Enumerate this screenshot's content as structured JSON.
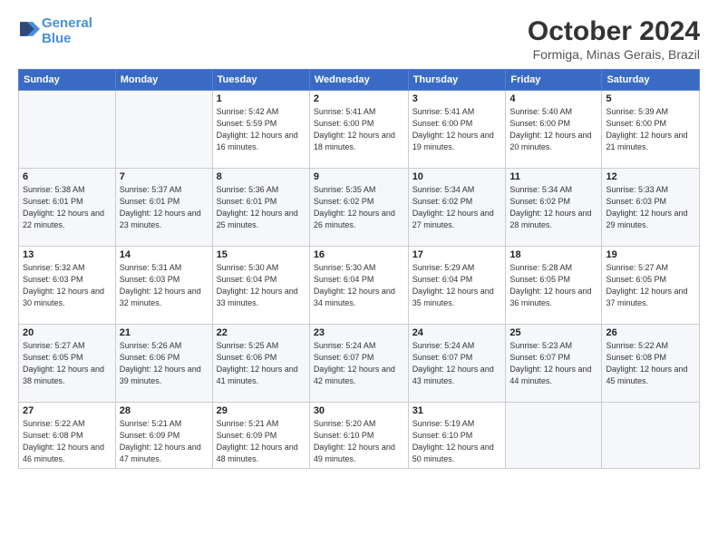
{
  "logo": {
    "line1": "General",
    "line2": "Blue"
  },
  "title": "October 2024",
  "subtitle": "Formiga, Minas Gerais, Brazil",
  "headers": [
    "Sunday",
    "Monday",
    "Tuesday",
    "Wednesday",
    "Thursday",
    "Friday",
    "Saturday"
  ],
  "weeks": [
    [
      {
        "day": "",
        "info": ""
      },
      {
        "day": "",
        "info": ""
      },
      {
        "day": "1",
        "info": "Sunrise: 5:42 AM\nSunset: 5:59 PM\nDaylight: 12 hours\nand 16 minutes."
      },
      {
        "day": "2",
        "info": "Sunrise: 5:41 AM\nSunset: 6:00 PM\nDaylight: 12 hours\nand 18 minutes."
      },
      {
        "day": "3",
        "info": "Sunrise: 5:41 AM\nSunset: 6:00 PM\nDaylight: 12 hours\nand 19 minutes."
      },
      {
        "day": "4",
        "info": "Sunrise: 5:40 AM\nSunset: 6:00 PM\nDaylight: 12 hours\nand 20 minutes."
      },
      {
        "day": "5",
        "info": "Sunrise: 5:39 AM\nSunset: 6:00 PM\nDaylight: 12 hours\nand 21 minutes."
      }
    ],
    [
      {
        "day": "6",
        "info": "Sunrise: 5:38 AM\nSunset: 6:01 PM\nDaylight: 12 hours\nand 22 minutes."
      },
      {
        "day": "7",
        "info": "Sunrise: 5:37 AM\nSunset: 6:01 PM\nDaylight: 12 hours\nand 23 minutes."
      },
      {
        "day": "8",
        "info": "Sunrise: 5:36 AM\nSunset: 6:01 PM\nDaylight: 12 hours\nand 25 minutes."
      },
      {
        "day": "9",
        "info": "Sunrise: 5:35 AM\nSunset: 6:02 PM\nDaylight: 12 hours\nand 26 minutes."
      },
      {
        "day": "10",
        "info": "Sunrise: 5:34 AM\nSunset: 6:02 PM\nDaylight: 12 hours\nand 27 minutes."
      },
      {
        "day": "11",
        "info": "Sunrise: 5:34 AM\nSunset: 6:02 PM\nDaylight: 12 hours\nand 28 minutes."
      },
      {
        "day": "12",
        "info": "Sunrise: 5:33 AM\nSunset: 6:03 PM\nDaylight: 12 hours\nand 29 minutes."
      }
    ],
    [
      {
        "day": "13",
        "info": "Sunrise: 5:32 AM\nSunset: 6:03 PM\nDaylight: 12 hours\nand 30 minutes."
      },
      {
        "day": "14",
        "info": "Sunrise: 5:31 AM\nSunset: 6:03 PM\nDaylight: 12 hours\nand 32 minutes."
      },
      {
        "day": "15",
        "info": "Sunrise: 5:30 AM\nSunset: 6:04 PM\nDaylight: 12 hours\nand 33 minutes."
      },
      {
        "day": "16",
        "info": "Sunrise: 5:30 AM\nSunset: 6:04 PM\nDaylight: 12 hours\nand 34 minutes."
      },
      {
        "day": "17",
        "info": "Sunrise: 5:29 AM\nSunset: 6:04 PM\nDaylight: 12 hours\nand 35 minutes."
      },
      {
        "day": "18",
        "info": "Sunrise: 5:28 AM\nSunset: 6:05 PM\nDaylight: 12 hours\nand 36 minutes."
      },
      {
        "day": "19",
        "info": "Sunrise: 5:27 AM\nSunset: 6:05 PM\nDaylight: 12 hours\nand 37 minutes."
      }
    ],
    [
      {
        "day": "20",
        "info": "Sunrise: 5:27 AM\nSunset: 6:05 PM\nDaylight: 12 hours\nand 38 minutes."
      },
      {
        "day": "21",
        "info": "Sunrise: 5:26 AM\nSunset: 6:06 PM\nDaylight: 12 hours\nand 39 minutes."
      },
      {
        "day": "22",
        "info": "Sunrise: 5:25 AM\nSunset: 6:06 PM\nDaylight: 12 hours\nand 41 minutes."
      },
      {
        "day": "23",
        "info": "Sunrise: 5:24 AM\nSunset: 6:07 PM\nDaylight: 12 hours\nand 42 minutes."
      },
      {
        "day": "24",
        "info": "Sunrise: 5:24 AM\nSunset: 6:07 PM\nDaylight: 12 hours\nand 43 minutes."
      },
      {
        "day": "25",
        "info": "Sunrise: 5:23 AM\nSunset: 6:07 PM\nDaylight: 12 hours\nand 44 minutes."
      },
      {
        "day": "26",
        "info": "Sunrise: 5:22 AM\nSunset: 6:08 PM\nDaylight: 12 hours\nand 45 minutes."
      }
    ],
    [
      {
        "day": "27",
        "info": "Sunrise: 5:22 AM\nSunset: 6:08 PM\nDaylight: 12 hours\nand 46 minutes."
      },
      {
        "day": "28",
        "info": "Sunrise: 5:21 AM\nSunset: 6:09 PM\nDaylight: 12 hours\nand 47 minutes."
      },
      {
        "day": "29",
        "info": "Sunrise: 5:21 AM\nSunset: 6:09 PM\nDaylight: 12 hours\nand 48 minutes."
      },
      {
        "day": "30",
        "info": "Sunrise: 5:20 AM\nSunset: 6:10 PM\nDaylight: 12 hours\nand 49 minutes."
      },
      {
        "day": "31",
        "info": "Sunrise: 5:19 AM\nSunset: 6:10 PM\nDaylight: 12 hours\nand 50 minutes."
      },
      {
        "day": "",
        "info": ""
      },
      {
        "day": "",
        "info": ""
      }
    ]
  ]
}
